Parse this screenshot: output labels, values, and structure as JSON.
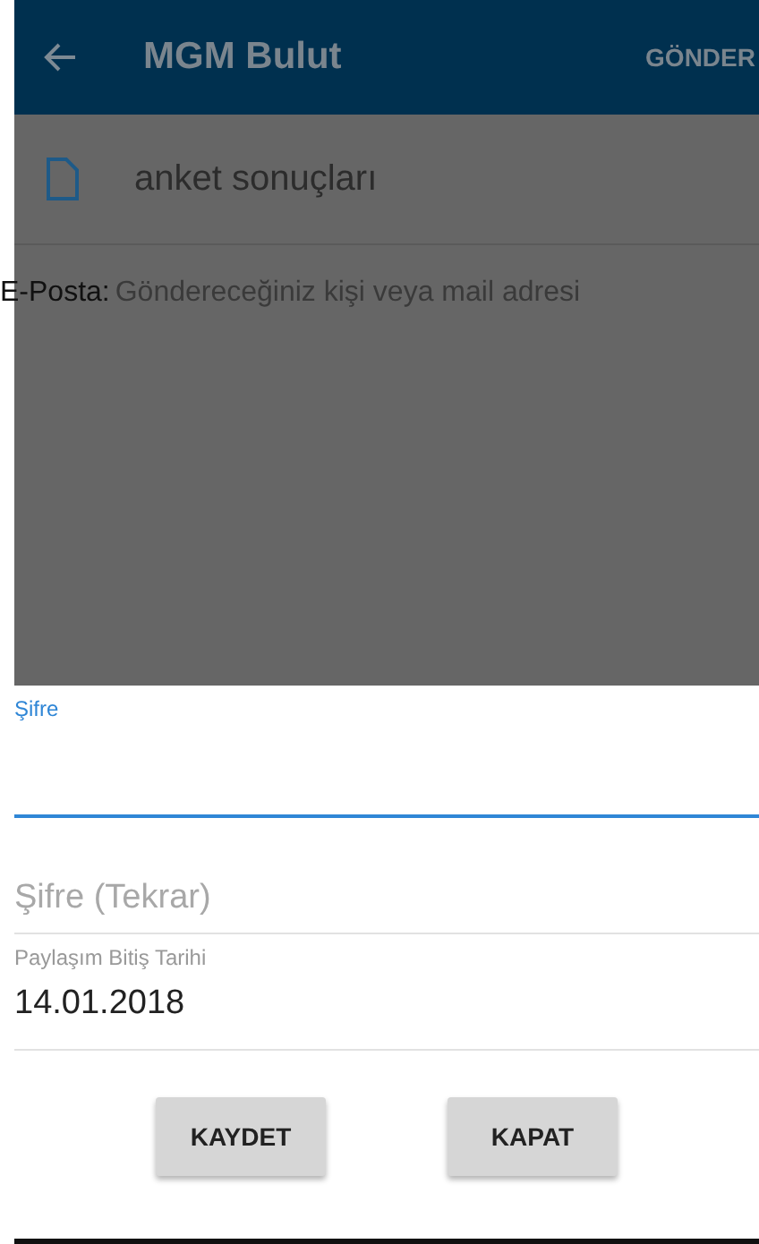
{
  "app_bar": {
    "title": "MGM Bulut",
    "action": "GÖNDER"
  },
  "file": {
    "name": "anket sonuçları"
  },
  "email": {
    "label": "E-Posta:",
    "placeholder": "Göndereceğiniz kişi veya mail adresi"
  },
  "dialog": {
    "fields": [
      {
        "kind": "floating",
        "label": "Şifre",
        "focused": true
      },
      {
        "kind": "plain",
        "placeholder": "Şifre (Tekrar)",
        "focused": false
      },
      {
        "kind": "floating",
        "label": "Paylaşım Bitiş Tarihi",
        "value": "14.01.2018",
        "focused": false
      }
    ],
    "buttons": [
      "KAYDET",
      "KAPAT"
    ]
  }
}
